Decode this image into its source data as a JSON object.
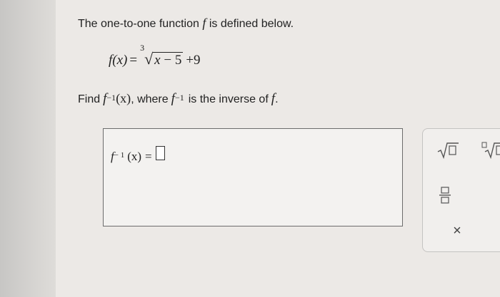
{
  "question": {
    "intro": "The one-to-one function",
    "intro_f": "f",
    "intro_end": "is defined below.",
    "definition": {
      "lhs": "f(x)",
      "equals": "=",
      "root_index": "3",
      "radicand_var": "x",
      "radicand_rest": "− 5",
      "tail": "+9"
    },
    "find_prefix": "Find",
    "inverse_f": "f",
    "inverse_exp": "−1",
    "inverse_arg": "(x)",
    "where": ", where",
    "is_inverse_of": "is the inverse of",
    "final_f": "f",
    "period": "."
  },
  "answer": {
    "lhs_f": "f",
    "lhs_exp": "− 1",
    "lhs_arg": "(x)",
    "equals": "=",
    "input_value": ""
  },
  "palette": {
    "buttons": [
      "sqrt-icon",
      "nth-root-icon",
      "fraction-icon",
      "clear-icon"
    ],
    "clear_symbol": "×"
  }
}
